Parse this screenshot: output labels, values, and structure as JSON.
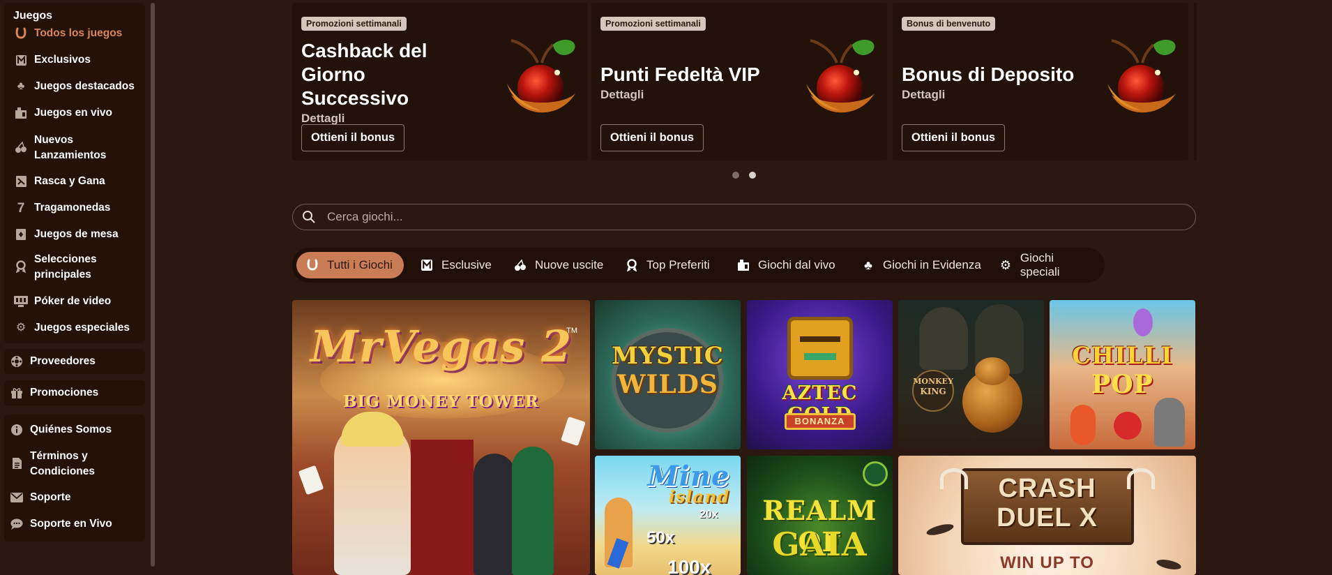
{
  "sidebar": {
    "heading": "Juegos",
    "items": [
      {
        "label": "Todos los juegos",
        "icon": "horseshoe-icon",
        "active": true
      },
      {
        "label": "Exclusivos",
        "icon": "exclusive-icon"
      },
      {
        "label": "Juegos destacados",
        "icon": "clover-icon"
      },
      {
        "label": "Juegos en vivo",
        "icon": "live-icon"
      },
      {
        "label": "Nuevos\nLanzamientos",
        "icon": "cherries-icon"
      },
      {
        "label": "Rasca y Gana",
        "icon": "scratch-card-icon"
      },
      {
        "label": "Tragamonedas",
        "icon": "seven-icon"
      },
      {
        "label": "Juegos de mesa",
        "icon": "table-game-icon"
      },
      {
        "label": "Selecciones\nprincipales",
        "icon": "award-icon"
      },
      {
        "label": "Póker de video",
        "icon": "video-poker-icon"
      },
      {
        "label": "Juegos especiales",
        "icon": "gear-icon"
      }
    ],
    "providers": "Proveedores",
    "promotions": "Promociones",
    "info_items": [
      {
        "label": "Quiénes Somos",
        "icon": "info-icon"
      },
      {
        "label": "Términos y\nCondiciones",
        "icon": "document-icon"
      },
      {
        "label": "Soporte",
        "icon": "mail-icon"
      },
      {
        "label": "Soporte en Vivo",
        "icon": "chat-icon"
      }
    ]
  },
  "promos": [
    {
      "badge": "Promozioni settimanali",
      "title": "Cashback del Giorno Successivo",
      "link": "Dettagli",
      "button": "Ottieni il bonus"
    },
    {
      "badge": "Promozioni settimanali",
      "title": "Punti Fedeltà VIP",
      "link": "Dettagli",
      "button": "Ottieni il bonus"
    },
    {
      "badge": "Bonus di benvenuto",
      "title": "Bonus di Deposito",
      "link": "Dettagli",
      "button": "Ottieni il bonus"
    }
  ],
  "carousel": {
    "pages": 2,
    "current": 2
  },
  "search": {
    "placeholder": "Cerca giochi..."
  },
  "tabs": [
    {
      "label": "Tutti i Giochi",
      "icon": "horseshoe-icon",
      "active": true
    },
    {
      "label": "Esclusive",
      "icon": "exclusive-icon"
    },
    {
      "label": "Nuove uscite",
      "icon": "cherries-icon"
    },
    {
      "label": "Top Preferiti",
      "icon": "award-icon"
    },
    {
      "label": "Giochi dal vivo",
      "icon": "live-icon"
    },
    {
      "label": "Giochi in Evidenza",
      "icon": "clover-icon"
    },
    {
      "label": "Giochi speciali",
      "icon": "gear-icon"
    }
  ],
  "games": {
    "mr_vegas": {
      "title": "MrVegas 2",
      "subtitle": "BIG MONEY TOWER",
      "tm": "TM"
    },
    "mystic": {
      "line1": "MYSTIC",
      "line2": "WILDS"
    },
    "aztec": {
      "line1": "AZTEC GOLD",
      "line2": "BONANZA"
    },
    "monkey": {
      "line1": "MONKEY",
      "line2": "KING"
    },
    "chilli": {
      "line1": "CHILLI",
      "line2": "POP"
    },
    "mine": {
      "line1": "Mine",
      "line2": "island",
      "mult1": "20x",
      "mult2": "50x",
      "mult3": "100x"
    },
    "gaia": {
      "line1": "REALM OF",
      "line2": "GAIA"
    },
    "crash": {
      "line1": "CRASH",
      "line2": "DUEL X",
      "line3": "WIN UP TO"
    }
  }
}
